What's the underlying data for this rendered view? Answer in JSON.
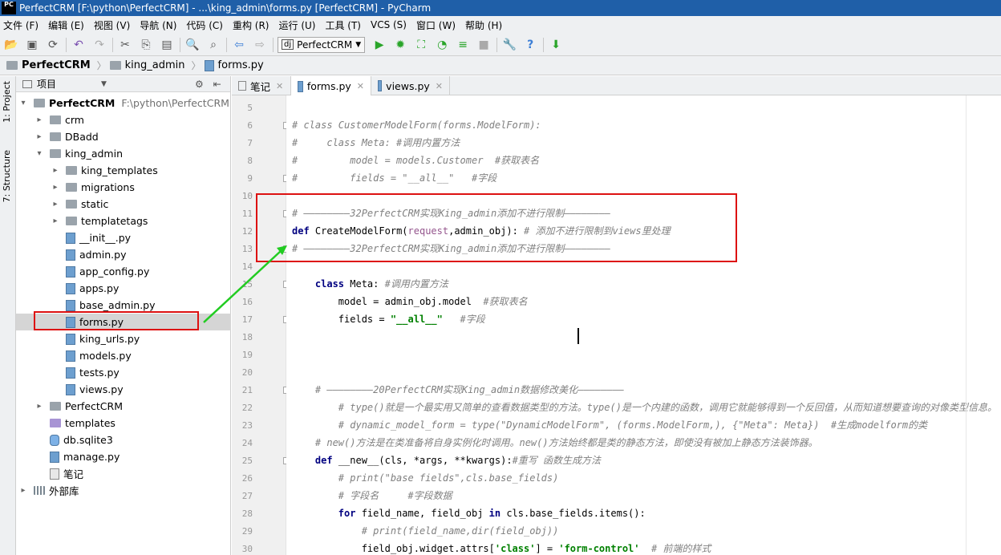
{
  "window": {
    "title": "PerfectCRM [F:\\python\\PerfectCRM] - ...\\king_admin\\forms.py [PerfectCRM] - PyCharm",
    "app_icon": "PC"
  },
  "menu": [
    "文件 (F)",
    "编辑 (E)",
    "视图 (V)",
    "导航 (N)",
    "代码 (C)",
    "重构 (R)",
    "运行 (U)",
    "工具 (T)",
    "VCS (S)",
    "窗口 (W)",
    "帮助 (H)"
  ],
  "toolbar": {
    "run_config": "PerfectCRM",
    "icons": [
      "open-icon",
      "save-icon",
      "sync-icon",
      "undo-icon",
      "redo-icon",
      "cut-icon",
      "copy-icon",
      "paste-icon",
      "find-icon",
      "replace-icon",
      "back-icon",
      "forward-icon",
      "run-icon",
      "debug-icon",
      "coverage-icon",
      "profile-icon",
      "concurrency-icon",
      "stop-icon",
      "settings-icon",
      "help-icon",
      "vcs-icon"
    ]
  },
  "breadcrumb": [
    "PerfectCRM",
    "king_admin",
    "forms.py"
  ],
  "side_tabs": [
    "1: Project",
    "7: Structure"
  ],
  "project_panel": {
    "title": "项目",
    "root": {
      "name": "PerfectCRM",
      "path": "F:\\python\\PerfectCRM"
    },
    "items": [
      {
        "name": "crm",
        "type": "folder",
        "depth": 1,
        "arrow": "▸"
      },
      {
        "name": "DBadd",
        "type": "folder",
        "depth": 1,
        "arrow": "▸"
      },
      {
        "name": "king_admin",
        "type": "folder",
        "depth": 1,
        "arrow": "▾"
      },
      {
        "name": "king_templates",
        "type": "folder",
        "depth": 2,
        "arrow": "▸"
      },
      {
        "name": "migrations",
        "type": "folder",
        "depth": 2,
        "arrow": "▸"
      },
      {
        "name": "static",
        "type": "folder",
        "depth": 2,
        "arrow": "▸"
      },
      {
        "name": "templatetags",
        "type": "folder",
        "depth": 2,
        "arrow": "▸"
      },
      {
        "name": "__init__.py",
        "type": "py",
        "depth": 2,
        "arrow": ""
      },
      {
        "name": "admin.py",
        "type": "py",
        "depth": 2,
        "arrow": ""
      },
      {
        "name": "app_config.py",
        "type": "py",
        "depth": 2,
        "arrow": ""
      },
      {
        "name": "apps.py",
        "type": "py",
        "depth": 2,
        "arrow": ""
      },
      {
        "name": "base_admin.py",
        "type": "py",
        "depth": 2,
        "arrow": ""
      },
      {
        "name": "forms.py",
        "type": "py",
        "depth": 2,
        "arrow": "",
        "selected": true
      },
      {
        "name": "king_urls.py",
        "type": "py",
        "depth": 2,
        "arrow": ""
      },
      {
        "name": "models.py",
        "type": "py",
        "depth": 2,
        "arrow": ""
      },
      {
        "name": "tests.py",
        "type": "py",
        "depth": 2,
        "arrow": ""
      },
      {
        "name": "views.py",
        "type": "py",
        "depth": 2,
        "arrow": ""
      },
      {
        "name": "PerfectCRM",
        "type": "folder",
        "depth": 1,
        "arrow": "▸"
      },
      {
        "name": "templates",
        "type": "folder-purple",
        "depth": 1,
        "arrow": ""
      },
      {
        "name": "db.sqlite3",
        "type": "db",
        "depth": 1,
        "arrow": ""
      },
      {
        "name": "manage.py",
        "type": "py",
        "depth": 1,
        "arrow": ""
      },
      {
        "name": "笔记",
        "type": "file",
        "depth": 1,
        "arrow": ""
      },
      {
        "name": "外部库",
        "type": "lib",
        "depth": 0,
        "arrow": "▸"
      }
    ]
  },
  "tabs": [
    {
      "label": "笔记",
      "active": false
    },
    {
      "label": "forms.py",
      "active": true
    },
    {
      "label": "views.py",
      "active": false
    }
  ],
  "editor": {
    "lines": [
      {
        "n": "5",
        "html": ""
      },
      {
        "n": "6",
        "html": "<span class=\"cm\"># class CustomerModelForm(forms.ModelForm):</span>"
      },
      {
        "n": "7",
        "html": "<span class=\"cm\">#     class Meta: #调用内置方法</span>"
      },
      {
        "n": "8",
        "html": "<span class=\"cm\">#         model = models.Customer  #获取表名</span>"
      },
      {
        "n": "9",
        "html": "<span class=\"cm\">#         fields = \"__all__\"   #字段</span>"
      },
      {
        "n": "10",
        "html": ""
      },
      {
        "n": "11",
        "html": "<span class=\"cm\"># ————————32PerfectCRM实现King_admin添加不进行限制————————</span>"
      },
      {
        "n": "12",
        "html": "<span class=\"kw\">def</span> <span class=\"fn\">CreateModelForm</span>(<span class=\"pa\">request</span>,admin_obj): <span class=\"cm\"># 添加不进行限制到views里处理</span>"
      },
      {
        "n": "13",
        "html": "<span class=\"cm\"># ————————32PerfectCRM实现King_admin添加不进行限制————————</span>"
      },
      {
        "n": "14",
        "html": ""
      },
      {
        "n": "15",
        "html": "    <span class=\"kw\">class</span> Meta: <span class=\"cm\">#调用内置方法</span>"
      },
      {
        "n": "16",
        "html": "        model = admin_obj.model  <span class=\"cm\">#获取表名</span>"
      },
      {
        "n": "17",
        "html": "        fields = <span class=\"st\">\"__all__\"</span>   <span class=\"cm\">#字段</span>"
      },
      {
        "n": "18",
        "html": ""
      },
      {
        "n": "19",
        "html": ""
      },
      {
        "n": "20",
        "html": ""
      },
      {
        "n": "21",
        "html": "    <span class=\"cm\"># ————————20PerfectCRM实现King_admin数据修改美化————————</span>"
      },
      {
        "n": "22",
        "html": "        <span class=\"cm\"># type()就是一个最实用又简单的查看数据类型的方法。type()是一个内建的函数，调用它就能够得到一个反回值，从而知道想要查询的对像类型信息。</span>"
      },
      {
        "n": "23",
        "html": "        <span class=\"cm\"># dynamic_model_form = type(\"DynamicModelForm\", (forms.ModelForm,), {\"Meta\": Meta})  #生成modelform的类</span>"
      },
      {
        "n": "24",
        "html": "    <span class=\"cm\"># new()方法是在类准备将自身实例化时调用。new()方法始终都是类的静态方法，即使没有被加上静态方法装饰器。</span>"
      },
      {
        "n": "25",
        "html": "    <span class=\"kw\">def</span> <span class=\"fn\">__new__</span>(cls, *args, **kwargs):<span class=\"cm\">#重写 函数生成方法</span>"
      },
      {
        "n": "26",
        "html": "        <span class=\"cm\"># print(\"base fields\",cls.base_fields)</span>"
      },
      {
        "n": "27",
        "html": "        <span class=\"cm\"># 字段名     #字段数据</span>"
      },
      {
        "n": "28",
        "html": "        <span class=\"kw\">for</span> field_name, field_obj <span class=\"kw\">in</span> cls.base_fields.items():"
      },
      {
        "n": "29",
        "html": "            <span class=\"cm\"># print(field_name,dir(field_obj))</span>"
      },
      {
        "n": "30",
        "html": "            field_obj.widget.attrs[<span class=\"st\">'class'</span>] = <span class=\"st\">'form-control'</span>  <span class=\"cm\"># 前端的样式</span>"
      }
    ]
  },
  "annotation_colors": {
    "box": "#dd1111",
    "arrow": "#22cc22"
  }
}
